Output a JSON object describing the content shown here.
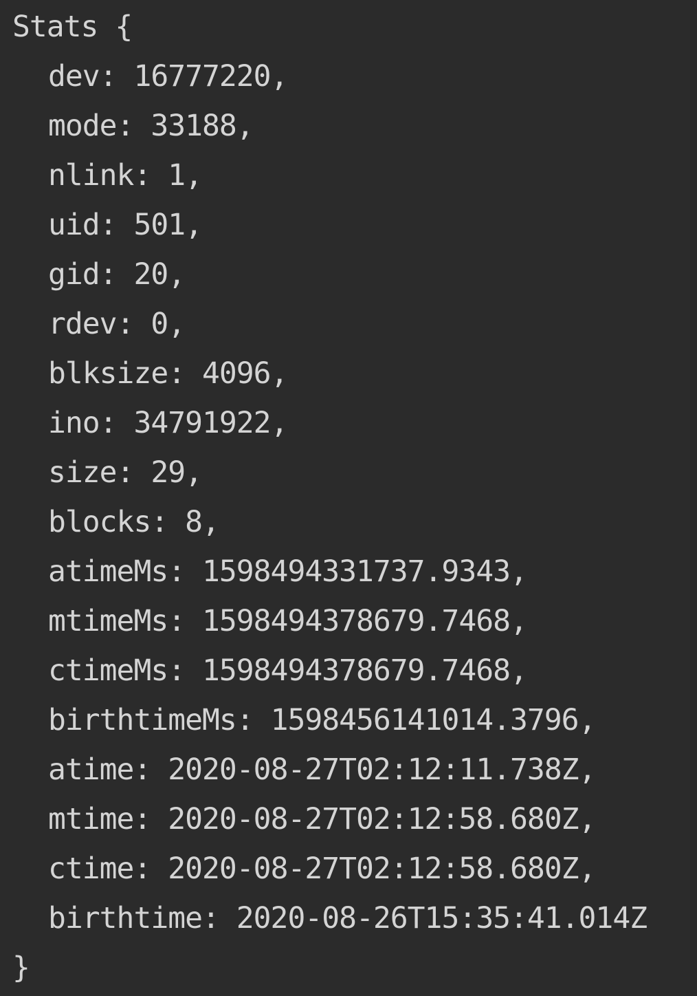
{
  "console": {
    "class_name": "Stats",
    "open_brace": "{",
    "close_brace": "}",
    "properties": [
      {
        "key": "dev",
        "value": "16777220",
        "suffix": ","
      },
      {
        "key": "mode",
        "value": "33188",
        "suffix": ","
      },
      {
        "key": "nlink",
        "value": "1",
        "suffix": ","
      },
      {
        "key": "uid",
        "value": "501",
        "suffix": ","
      },
      {
        "key": "gid",
        "value": "20",
        "suffix": ","
      },
      {
        "key": "rdev",
        "value": "0",
        "suffix": ","
      },
      {
        "key": "blksize",
        "value": "4096",
        "suffix": ","
      },
      {
        "key": "ino",
        "value": "34791922",
        "suffix": ","
      },
      {
        "key": "size",
        "value": "29",
        "suffix": ","
      },
      {
        "key": "blocks",
        "value": "8",
        "suffix": ","
      },
      {
        "key": "atimeMs",
        "value": "1598494331737.9343",
        "suffix": ","
      },
      {
        "key": "mtimeMs",
        "value": "1598494378679.7468",
        "suffix": ","
      },
      {
        "key": "ctimeMs",
        "value": "1598494378679.7468",
        "suffix": ","
      },
      {
        "key": "birthtimeMs",
        "value": "1598456141014.3796",
        "suffix": ","
      },
      {
        "key": "atime",
        "value": "2020-08-27T02:12:11.738Z",
        "suffix": ","
      },
      {
        "key": "mtime",
        "value": "2020-08-27T02:12:58.680Z",
        "suffix": ","
      },
      {
        "key": "ctime",
        "value": "2020-08-27T02:12:58.680Z",
        "suffix": ","
      },
      {
        "key": "birthtime",
        "value": "2020-08-26T15:35:41.014Z",
        "suffix": ""
      }
    ]
  }
}
